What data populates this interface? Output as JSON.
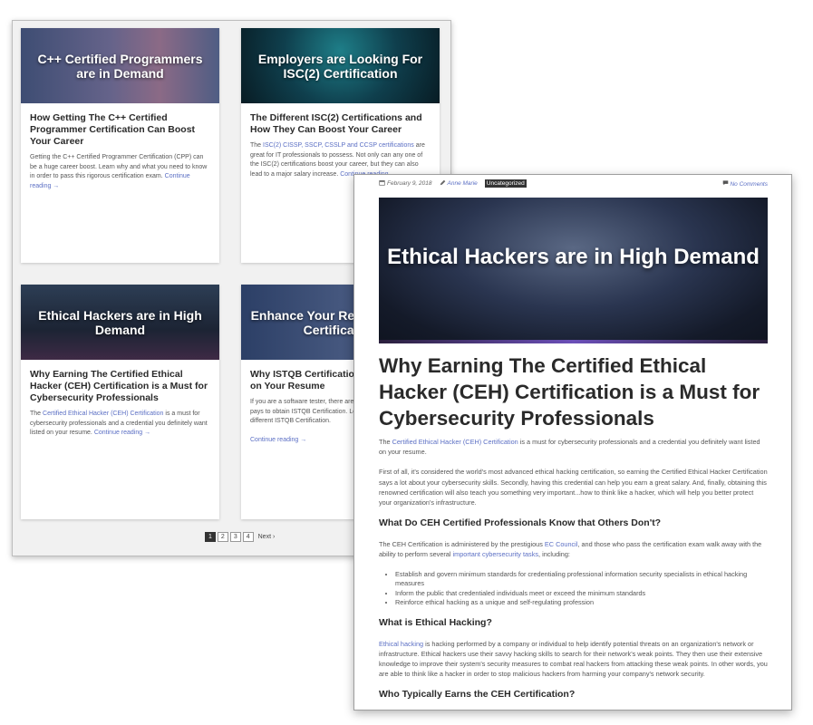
{
  "grid": {
    "cards": [
      {
        "image_text": "C++ Certified Programmers are in Demand",
        "title": "How Getting The C++ Certified Programmer Certification Can Boost Your Career",
        "excerpt": "Getting the C++ Certified Programmer Certification (CPP) can be a huge career boost. Learn why and what you need to know in order to pass this rigorous certification exam.",
        "more": "Continue reading →"
      },
      {
        "image_text": "Employers are Looking For ISC(2) Certification",
        "title": "The Different ISC(2) Certifications and How They Can Boost Your Career",
        "excerpt_pre": "The ",
        "excerpt_link": "ISC(2) CISSP, SSCP, CSSLP and CCSP certifications",
        "excerpt_post": " are great for IT professionals to possess. Not only can any one of the ISC(2) certifications boost your career, but they can also lead to a major salary increase.",
        "more": "Continue reading →"
      },
      {
        "image_text": "Ethical Hackers are in High Demand",
        "title": "Why Earning The Certified Ethical Hacker (CEH) Certification is a Must for Cybersecurity Professionals",
        "excerpt_pre": "The ",
        "excerpt_link": "Certified Ethical Hacker (CEH) Certification",
        "excerpt_post": " is a must for cybersecurity professionals and a credential you definitely want listed on your resume.",
        "more": "Continue reading →"
      },
      {
        "image_text": "Enhance Your Resume ISTQB Certification",
        "title": "Why ISTQB Certification Will Enhance on Your Resume",
        "excerpt": "If you are a software tester, there are few certifications that it pays to obtain ISTQB Certification. Learn more about the different ISTQB Certification.",
        "more": "Continue reading →"
      }
    ],
    "pagination": {
      "pages": [
        "1",
        "2",
        "3",
        "4"
      ],
      "next": "Next ›"
    }
  },
  "article": {
    "date": "February 9, 2018",
    "author": "Anne Marie",
    "category": "Uncategorized",
    "comments": "No Comments",
    "hero_text": "Ethical Hackers are in High Demand",
    "title": "Why Earning The Certified Ethical Hacker (CEH) Certification is a Must for Cybersecurity Professionals",
    "intro_pre": "The ",
    "intro_link": "Certified Ethical Hacker (CEH) Certification",
    "intro_post": " is a must for cybersecurity professionals and a credential you definitely want listed on your resume.",
    "para1": "First of all, it's considered the world's most advanced ethical hacking certification, so earning the Certified Ethical Hacker Certification says a lot about your cybersecurity skills. Secondly, having this credential can help you earn a great salary. And, finally, obtaining this renowned certification will also teach you something very important...how to think like a hacker, which will help you better protect your organization's infrastructure.",
    "h2_1": "What Do CEH Certified Professionals Know that Others Don't?",
    "para2_pre": "The CEH Certification is administered by the prestigious ",
    "para2_link1": "EC Council",
    "para2_mid": ", and those who pass the certification exam walk away with the ability to perform several ",
    "para2_link2": "important cybersecurity tasks",
    "para2_post": ", including:",
    "bullets": [
      "Establish and govern minimum standards for credentialing professional information security specialists in ethical hacking measures",
      "Inform the public that credentialed individuals meet or exceed the minimum standards",
      "Reinforce ethical hacking as a unique and self-regulating profession"
    ],
    "h2_2": "What is Ethical Hacking?",
    "para3_link": "Ethical hacking",
    "para3_post": " is hacking performed by a company or individual to help identify potential threats on an organization's network or infrastructure. Ethical hackers use their savvy hacking skills to search for their network's weak points. They then use their extensive knowledge to improve their system's security measures to combat real hackers from attacking these weak points. In other words, you are able to think like a hacker in order to stop malicious hackers from harming your company's network security.",
    "h2_3": "Who Typically Earns the CEH Certification?"
  }
}
